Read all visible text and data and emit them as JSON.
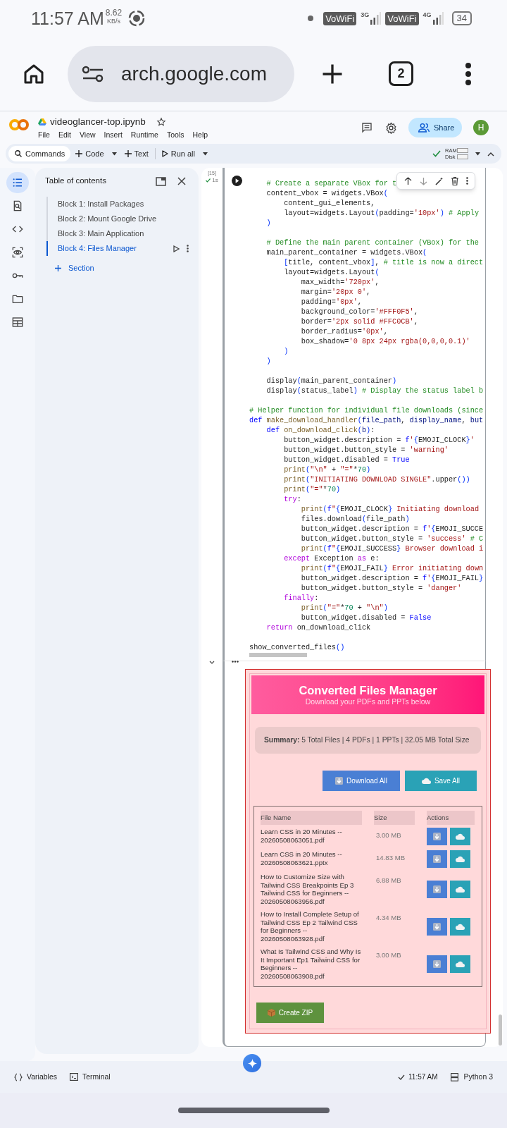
{
  "status_bar": {
    "time": "11:57 AM",
    "net_speed": "8.62",
    "net_speed_unit": "KB/s",
    "indicators": [
      {
        "kind": "badge",
        "text": "VoWiFi"
      },
      {
        "kind": "signal",
        "text": "3G"
      },
      {
        "kind": "badge",
        "text": "VoWiFi"
      },
      {
        "kind": "signal",
        "text": "4G"
      }
    ],
    "battery": "34"
  },
  "browser": {
    "url": "arch.google.com",
    "tab_count": "2"
  },
  "colab_header": {
    "file_title": "videoglancer-top.ipynb",
    "menu": [
      "File",
      "Edit",
      "View",
      "Insert",
      "Runtime",
      "Tools",
      "Help"
    ],
    "share_label": "Share",
    "avatar_letter": "H"
  },
  "toolbar": {
    "items": [
      {
        "kind": "search",
        "label": "Commands",
        "caret": false
      },
      {
        "kind": "add",
        "label": "Code",
        "caret": true
      },
      {
        "kind": "add",
        "label": "Text",
        "caret": false
      },
      {
        "kind": "run",
        "label": "Run all",
        "caret": true
      }
    ],
    "resources": [
      {
        "label": "RAM"
      },
      {
        "label": "Disk"
      }
    ]
  },
  "side_rail": [
    {
      "kind": "toc",
      "selected": true
    },
    {
      "kind": "find",
      "selected": false
    },
    {
      "kind": "code",
      "selected": false
    },
    {
      "kind": "eye",
      "selected": false
    },
    {
      "kind": "key",
      "selected": false
    },
    {
      "kind": "folder",
      "selected": false
    },
    {
      "kind": "table",
      "selected": false
    }
  ],
  "toc": {
    "title": "Table of contents",
    "items": [
      {
        "label": "Block 1: Install Packages",
        "selected": false
      },
      {
        "label": "Block 2: Mount Google Drive",
        "selected": false
      },
      {
        "label": "Block 3: Main Application",
        "selected": false
      },
      {
        "label": "Block 4: Files Manager",
        "selected": true
      }
    ],
    "add_label": "Section"
  },
  "cell": {
    "execution_count": "[15]",
    "duration": "1s",
    "code_lines": [
      {
        "kind": "code",
        "segments": [
          {
            "kind": "comment",
            "text": "    # Create a separate VBox for t"
          }
        ]
      },
      {
        "kind": "code",
        "segments": [
          {
            "kind": "plain",
            "text": "    content_vbox = widgets.VBox"
          },
          {
            "kind": "bracket",
            "text": "("
          }
        ]
      },
      {
        "kind": "code",
        "segments": [
          {
            "kind": "plain",
            "text": "        content_gui_elements,"
          }
        ]
      },
      {
        "kind": "code",
        "segments": [
          {
            "kind": "plain",
            "text": "        layout=widgets.Layout"
          },
          {
            "kind": "bracket",
            "text": "("
          },
          {
            "kind": "plain",
            "text": "padding="
          },
          {
            "kind": "string",
            "text": "'10px'"
          },
          {
            "kind": "bracket",
            "text": ")"
          },
          {
            "kind": "comment",
            "text": " # Apply"
          }
        ]
      },
      {
        "kind": "code",
        "segments": [
          {
            "kind": "bracket",
            "text": "    )"
          }
        ]
      },
      {
        "kind": "blank"
      },
      {
        "kind": "code",
        "segments": [
          {
            "kind": "comment",
            "text": "    # Define the main parent container (VBox) for the"
          }
        ]
      },
      {
        "kind": "code",
        "segments": [
          {
            "kind": "plain",
            "text": "    main_parent_container = widgets.VBox"
          },
          {
            "kind": "bracket",
            "text": "("
          }
        ]
      },
      {
        "kind": "code",
        "segments": [
          {
            "kind": "bracket",
            "text": "        ["
          },
          {
            "kind": "plain",
            "text": "title, content_vbox"
          },
          {
            "kind": "bracket",
            "text": "]"
          },
          {
            "kind": "plain",
            "text": ", "
          },
          {
            "kind": "comment",
            "text": "# title is now a direct"
          }
        ]
      },
      {
        "kind": "code",
        "segments": [
          {
            "kind": "plain",
            "text": "        layout=widgets.Layout"
          },
          {
            "kind": "bracket",
            "text": "("
          }
        ]
      },
      {
        "kind": "code",
        "segments": [
          {
            "kind": "plain",
            "text": "            max_width="
          },
          {
            "kind": "string",
            "text": "'720px'"
          },
          {
            "kind": "plain",
            "text": ","
          }
        ]
      },
      {
        "kind": "code",
        "segments": [
          {
            "kind": "plain",
            "text": "            margin="
          },
          {
            "kind": "string",
            "text": "'20px 0'"
          },
          {
            "kind": "plain",
            "text": ","
          }
        ]
      },
      {
        "kind": "code",
        "segments": [
          {
            "kind": "plain",
            "text": "            padding="
          },
          {
            "kind": "string",
            "text": "'0px'"
          },
          {
            "kind": "plain",
            "text": ","
          }
        ]
      },
      {
        "kind": "code",
        "segments": [
          {
            "kind": "plain",
            "text": "            background_color="
          },
          {
            "kind": "string",
            "text": "'#FFF0F5'"
          },
          {
            "kind": "plain",
            "text": ","
          }
        ]
      },
      {
        "kind": "code",
        "segments": [
          {
            "kind": "plain",
            "text": "            border="
          },
          {
            "kind": "string",
            "text": "'2px solid #FFC0CB'"
          },
          {
            "kind": "plain",
            "text": ","
          }
        ]
      },
      {
        "kind": "code",
        "segments": [
          {
            "kind": "plain",
            "text": "            border_radius="
          },
          {
            "kind": "string",
            "text": "'0px'"
          },
          {
            "kind": "plain",
            "text": ","
          }
        ]
      },
      {
        "kind": "code",
        "segments": [
          {
            "kind": "plain",
            "text": "            box_shadow="
          },
          {
            "kind": "string",
            "text": "'0 8px 24px rgba(0,0,0,0.1)'"
          }
        ]
      },
      {
        "kind": "code",
        "segments": [
          {
            "kind": "bracket",
            "text": "        )"
          }
        ]
      },
      {
        "kind": "code",
        "segments": [
          {
            "kind": "bracket",
            "text": "    )"
          }
        ]
      },
      {
        "kind": "blank"
      },
      {
        "kind": "code",
        "segments": [
          {
            "kind": "plain",
            "text": "    display"
          },
          {
            "kind": "bracket",
            "text": "("
          },
          {
            "kind": "plain",
            "text": "main_parent_container"
          },
          {
            "kind": "bracket",
            "text": ")"
          }
        ]
      },
      {
        "kind": "code",
        "segments": [
          {
            "kind": "plain",
            "text": "    display"
          },
          {
            "kind": "bracket",
            "text": "("
          },
          {
            "kind": "plain",
            "text": "status_label"
          },
          {
            "kind": "bracket",
            "text": ")"
          },
          {
            "kind": "comment",
            "text": " # Display the status label b"
          }
        ]
      },
      {
        "kind": "blank"
      },
      {
        "kind": "code",
        "segments": [
          {
            "kind": "comment",
            "text": "# Helper function for individual file downloads (since"
          }
        ]
      },
      {
        "kind": "code",
        "segments": [
          {
            "kind": "keyword",
            "text": "def"
          },
          {
            "kind": "function",
            "text": " make_download_handler"
          },
          {
            "kind": "bracket",
            "text": "("
          },
          {
            "kind": "param",
            "text": "file_path"
          },
          {
            "kind": "plain",
            "text": ", "
          },
          {
            "kind": "param",
            "text": "display_name"
          },
          {
            "kind": "plain",
            "text": ", "
          },
          {
            "kind": "param",
            "text": "but"
          }
        ]
      },
      {
        "kind": "code",
        "segments": [
          {
            "kind": "keyword",
            "text": "    def"
          },
          {
            "kind": "function",
            "text": " on_download_click"
          },
          {
            "kind": "bracket",
            "text": "("
          },
          {
            "kind": "param",
            "text": "b"
          },
          {
            "kind": "bracket",
            "text": ")"
          },
          {
            "kind": "plain",
            "text": ":"
          }
        ]
      },
      {
        "kind": "code",
        "segments": [
          {
            "kind": "plain",
            "text": "        button_widget.description = "
          },
          {
            "kind": "keyword",
            "text": "f"
          },
          {
            "kind": "string",
            "text": "'"
          },
          {
            "kind": "bracket",
            "text": "{"
          },
          {
            "kind": "plain",
            "text": "EMOJI_CLOCK"
          },
          {
            "kind": "bracket",
            "text": "}"
          },
          {
            "kind": "string",
            "text": "'"
          }
        ]
      },
      {
        "kind": "code",
        "segments": [
          {
            "kind": "plain",
            "text": "        button_widget.button_style = "
          },
          {
            "kind": "string",
            "text": "'warning'"
          }
        ]
      },
      {
        "kind": "code",
        "segments": [
          {
            "kind": "plain",
            "text": "        button_widget.disabled = "
          },
          {
            "kind": "keyword",
            "text": "True"
          }
        ]
      },
      {
        "kind": "code",
        "segments": [
          {
            "kind": "function",
            "text": "        print"
          },
          {
            "kind": "bracket",
            "text": "("
          },
          {
            "kind": "string",
            "text": "\"\\n\""
          },
          {
            "kind": "plain",
            "text": " + "
          },
          {
            "kind": "string",
            "text": "\"=\""
          },
          {
            "kind": "plain",
            "text": "*"
          },
          {
            "kind": "number",
            "text": "70"
          },
          {
            "kind": "bracket",
            "text": ")"
          }
        ]
      },
      {
        "kind": "code",
        "segments": [
          {
            "kind": "function",
            "text": "        print"
          },
          {
            "kind": "bracket",
            "text": "("
          },
          {
            "kind": "string",
            "text": "\"INITIATING DOWNLOAD SINGLE\""
          },
          {
            "kind": "plain",
            "text": ".upper"
          },
          {
            "kind": "bracket",
            "text": "())"
          }
        ]
      },
      {
        "kind": "code",
        "segments": [
          {
            "kind": "function",
            "text": "        print"
          },
          {
            "kind": "bracket",
            "text": "("
          },
          {
            "kind": "string",
            "text": "\"=\""
          },
          {
            "kind": "plain",
            "text": "*"
          },
          {
            "kind": "number",
            "text": "70"
          },
          {
            "kind": "bracket",
            "text": ")"
          }
        ]
      },
      {
        "kind": "code",
        "segments": [
          {
            "kind": "control",
            "text": "        try"
          },
          {
            "kind": "plain",
            "text": ":"
          }
        ]
      },
      {
        "kind": "code",
        "segments": [
          {
            "kind": "function",
            "text": "            print"
          },
          {
            "kind": "bracket",
            "text": "("
          },
          {
            "kind": "keyword",
            "text": "f"
          },
          {
            "kind": "string",
            "text": "\""
          },
          {
            "kind": "bracket",
            "text": "{"
          },
          {
            "kind": "plain",
            "text": "EMOJI_CLOCK"
          },
          {
            "kind": "bracket",
            "text": "}"
          },
          {
            "kind": "string",
            "text": " Initiating download"
          }
        ]
      },
      {
        "kind": "code",
        "segments": [
          {
            "kind": "plain",
            "text": "            files.download"
          },
          {
            "kind": "bracket",
            "text": "("
          },
          {
            "kind": "plain",
            "text": "file_path"
          },
          {
            "kind": "bracket",
            "text": ")"
          }
        ]
      },
      {
        "kind": "code",
        "segments": [
          {
            "kind": "plain",
            "text": "            button_widget.description = "
          },
          {
            "kind": "keyword",
            "text": "f"
          },
          {
            "kind": "string",
            "text": "'"
          },
          {
            "kind": "bracket",
            "text": "{"
          },
          {
            "kind": "plain",
            "text": "EMOJI_SUCCE"
          }
        ]
      },
      {
        "kind": "code",
        "segments": [
          {
            "kind": "plain",
            "text": "            button_widget.button_style = "
          },
          {
            "kind": "string",
            "text": "'success'"
          },
          {
            "kind": "comment",
            "text": " # C"
          }
        ]
      },
      {
        "kind": "code",
        "segments": [
          {
            "kind": "function",
            "text": "            print"
          },
          {
            "kind": "bracket",
            "text": "("
          },
          {
            "kind": "keyword",
            "text": "f"
          },
          {
            "kind": "string",
            "text": "\""
          },
          {
            "kind": "bracket",
            "text": "{"
          },
          {
            "kind": "plain",
            "text": "EMOJI_SUCCESS"
          },
          {
            "kind": "bracket",
            "text": "}"
          },
          {
            "kind": "string",
            "text": " Browser download i"
          }
        ]
      },
      {
        "kind": "code",
        "segments": [
          {
            "kind": "control",
            "text": "        except"
          },
          {
            "kind": "plain",
            "text": " Exception "
          },
          {
            "kind": "control",
            "text": "as"
          },
          {
            "kind": "plain",
            "text": " e:"
          }
        ]
      },
      {
        "kind": "code",
        "segments": [
          {
            "kind": "function",
            "text": "            print"
          },
          {
            "kind": "bracket",
            "text": "("
          },
          {
            "kind": "keyword",
            "text": "f"
          },
          {
            "kind": "string",
            "text": "\""
          },
          {
            "kind": "bracket",
            "text": "{"
          },
          {
            "kind": "plain",
            "text": "EMOJI_FAIL"
          },
          {
            "kind": "bracket",
            "text": "}"
          },
          {
            "kind": "string",
            "text": " Error initiating down"
          }
        ]
      },
      {
        "kind": "code",
        "segments": [
          {
            "kind": "plain",
            "text": "            button_widget.description = "
          },
          {
            "kind": "keyword",
            "text": "f"
          },
          {
            "kind": "string",
            "text": "'"
          },
          {
            "kind": "bracket",
            "text": "{"
          },
          {
            "kind": "plain",
            "text": "EMOJI_FAIL"
          },
          {
            "kind": "bracket",
            "text": "}"
          }
        ]
      },
      {
        "kind": "code",
        "segments": [
          {
            "kind": "plain",
            "text": "            button_widget.button_style = "
          },
          {
            "kind": "string",
            "text": "'danger'"
          }
        ]
      },
      {
        "kind": "code",
        "segments": [
          {
            "kind": "control",
            "text": "        finally"
          },
          {
            "kind": "plain",
            "text": ":"
          }
        ]
      },
      {
        "kind": "code",
        "segments": [
          {
            "kind": "function",
            "text": "            print"
          },
          {
            "kind": "bracket",
            "text": "("
          },
          {
            "kind": "string",
            "text": "\"=\""
          },
          {
            "kind": "plain",
            "text": "*"
          },
          {
            "kind": "number",
            "text": "70"
          },
          {
            "kind": "plain",
            "text": " + "
          },
          {
            "kind": "string",
            "text": "\"\\n\""
          },
          {
            "kind": "bracket",
            "text": ")"
          }
        ]
      },
      {
        "kind": "code",
        "segments": [
          {
            "kind": "plain",
            "text": "            button_widget.disabled = "
          },
          {
            "kind": "keyword",
            "text": "False"
          }
        ]
      },
      {
        "kind": "code",
        "segments": [
          {
            "kind": "control",
            "text": "    return"
          },
          {
            "kind": "plain",
            "text": " on_download_click"
          }
        ]
      },
      {
        "kind": "blank"
      },
      {
        "kind": "code",
        "segments": [
          {
            "kind": "plain",
            "text": "show_converted_files"
          },
          {
            "kind": "bracket",
            "text": "()"
          }
        ]
      }
    ]
  },
  "output": {
    "title": "Converted Files Manager",
    "subtitle": "Download your PDFs and PPTs below",
    "summary": "**Summary:** 5 Total Files | 4 PDFs | 1 PPTs | 32.05 MB Total Size",
    "buttons": [
      {
        "kind": "download",
        "label": "Download All"
      },
      {
        "kind": "save",
        "label": "Save All"
      }
    ],
    "table": {
      "columns": [
        "File Name",
        "Size",
        "Actions"
      ],
      "rows": [
        {
          "file_name": "Learn CSS in 20 Minutes -- 20260508063051.pdf",
          "size": "3.00 MB"
        },
        {
          "file_name": "Learn CSS in 20 Minutes -- 20260508063621.pptx",
          "size": "14.83 MB"
        },
        {
          "file_name": "How to Customize Size with Tailwind CSS Breakpoints Ep 3 Tailwind CSS for Beginners -- 20260508063956.pdf",
          "size": "6.88 MB"
        },
        {
          "file_name": "How to Install Complete Setup of Tailwind CSS Ep 2 Tailwind CSS for Beginners -- 20260508063928.pdf",
          "size": "4.34 MB"
        },
        {
          "file_name": "What Is Tailwind CSS and Why Is It Important Ep1 Tailwind CSS for Beginners -- 20260508063908.pdf",
          "size": "3.00 MB"
        }
      ]
    },
    "zip_button": {
      "label": "Create ZIP"
    }
  },
  "bottom_bar": {
    "variables": "Variables",
    "terminal": "Terminal",
    "status_time": "11:57 AM",
    "runtime": "Python 3"
  }
}
